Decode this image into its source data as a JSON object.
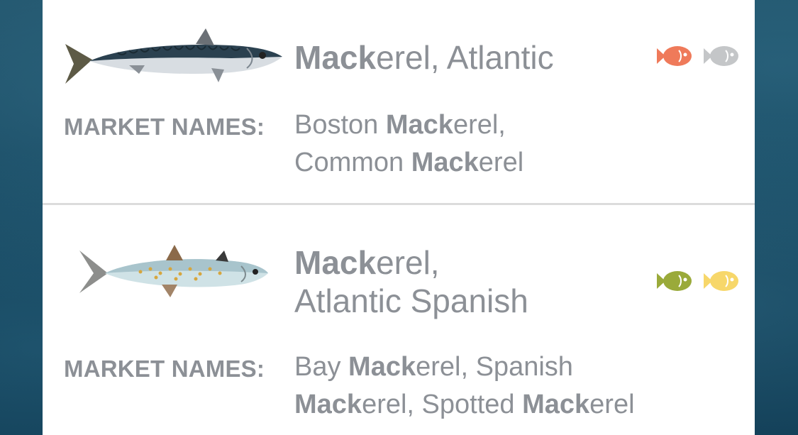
{
  "items": [
    {
      "name_bold": "Mack",
      "name_line1_rest": "erel, Atlantic",
      "name_line2": "",
      "market_label": "MARKET NAMES:",
      "market_line1": [
        {
          "t": "Boston ",
          "b": false
        },
        {
          "t": "Mack",
          "b": true
        },
        {
          "t": "erel,",
          "b": false
        }
      ],
      "market_line2": [
        {
          "t": "Common ",
          "b": false
        },
        {
          "t": "Mack",
          "b": true
        },
        {
          "t": "erel",
          "b": false
        }
      ],
      "rating_icons": [
        {
          "icon": "fish-icon",
          "color": "#ef7a5a"
        },
        {
          "icon": "fish-icon",
          "color": "#c4c6c8"
        }
      ]
    },
    {
      "name_bold": "Mack",
      "name_line1_rest": "erel,",
      "name_line2": "Atlantic Spanish",
      "market_label": "MARKET NAMES:",
      "market_line1": [
        {
          "t": "Bay ",
          "b": false
        },
        {
          "t": "Mack",
          "b": true
        },
        {
          "t": "erel, Spanish",
          "b": false
        }
      ],
      "market_line2": [
        {
          "t": "Mack",
          "b": true
        },
        {
          "t": "erel, Spotted ",
          "b": false
        },
        {
          "t": "Mack",
          "b": true
        },
        {
          "t": "erel",
          "b": false
        }
      ],
      "rating_icons": [
        {
          "icon": "fish-icon",
          "color": "#9aaa3a"
        },
        {
          "icon": "fish-icon",
          "color": "#f7d76a"
        }
      ]
    }
  ]
}
